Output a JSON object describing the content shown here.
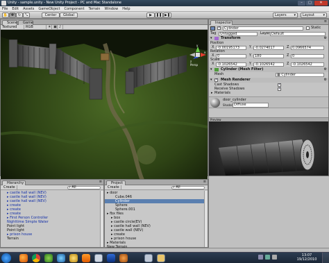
{
  "window": {
    "title": "Unity - sample.unity - New Unity Project - PC and Mac Standalone"
  },
  "menu": [
    "File",
    "Edit",
    "Assets",
    "GameObject",
    "Component",
    "Terrain",
    "Window",
    "Help"
  ],
  "toolbar": {
    "pivot_label": "Center",
    "space_label": "Global",
    "layers_label": "Layers",
    "layout_label": "Layout"
  },
  "scene_panel": {
    "tabs": [
      "Scene",
      "Game"
    ],
    "draw_mode": "Textured",
    "render_mode": "RGB",
    "persp_label": "Persp",
    "gizmo_y": "y",
    "gizmo_x": "x",
    "gizmo_z": "z"
  },
  "inspector": {
    "tab": "Inspector",
    "object_name": "Cylinder",
    "static_label": "Static",
    "tag_label": "Tag",
    "tag_value": "Untagged",
    "layer_label": "Layer",
    "layer_value": "Default",
    "transform": {
      "title": "Transform",
      "position_label": "Position",
      "position": {
        "x": "-0.00195173",
        "y": "-0.0274017",
        "z": "0.0966574"
      },
      "rotation_label": "Rotation",
      "rotation": {
        "x": "0",
        "y": "180",
        "z": "0"
      },
      "scale_label": "Scale",
      "scale": {
        "x": "-0.1026542",
        "y": "-0.1026542",
        "z": "-0.1026542"
      }
    },
    "mesh_filter": {
      "title": "Cylinder (Mesh Filter)",
      "mesh_label": "Mesh",
      "mesh_value": "Cylinder"
    },
    "mesh_renderer": {
      "title": "Mesh Renderer",
      "cast_label": "Cast Shadows",
      "receive_label": "Receive Shadows",
      "materials_label": "Materials"
    },
    "material": {
      "name": "door_cylinder",
      "shader_label": "Shader",
      "shader_value": "Diffuse"
    },
    "preview_label": "Preview"
  },
  "hierarchy": {
    "tab": "Hierarchy",
    "create_label": "Create",
    "search_placeholder": "All",
    "items": [
      {
        "label": "castle hall wall (NEV)",
        "indent": 1,
        "arrow": true,
        "blue": true,
        "selected": false
      },
      {
        "label": "castle hall wall (NEV)",
        "indent": 1,
        "arrow": true,
        "blue": true,
        "selected": false
      },
      {
        "label": "castle hall wall (NEV)",
        "indent": 1,
        "arrow": true,
        "blue": true,
        "selected": false
      },
      {
        "label": "create",
        "indent": 1,
        "arrow": true,
        "blue": true,
        "selected": false
      },
      {
        "label": "create",
        "indent": 1,
        "arrow": true,
        "blue": true,
        "selected": false
      },
      {
        "label": "create",
        "indent": 1,
        "arrow": true,
        "blue": true,
        "selected": false
      },
      {
        "label": "First Person Controller",
        "indent": 1,
        "arrow": true,
        "blue": true,
        "selected": false
      },
      {
        "label": "Nighttime Simple Water",
        "indent": 1,
        "arrow": false,
        "blue": true,
        "selected": false
      },
      {
        "label": "Point light",
        "indent": 1,
        "arrow": false,
        "blue": false,
        "selected": false
      },
      {
        "label": "Point light",
        "indent": 1,
        "arrow": false,
        "blue": false,
        "selected": false
      },
      {
        "label": "prison house",
        "indent": 1,
        "arrow": true,
        "blue": true,
        "selected": false
      },
      {
        "label": "Terrain",
        "indent": 1,
        "arrow": false,
        "blue": false,
        "selected": false
      }
    ]
  },
  "project": {
    "tab": "Project",
    "create_label": "Create",
    "search_placeholder": "All",
    "items": [
      {
        "label": "door",
        "indent": 0,
        "arrow": true,
        "blue": false,
        "selected": false
      },
      {
        "label": "Cube.046",
        "indent": 2,
        "arrow": false,
        "blue": false,
        "selected": false
      },
      {
        "label": "Cylinder",
        "indent": 2,
        "arrow": false,
        "blue": false,
        "selected": true
      },
      {
        "label": "Sphere",
        "indent": 2,
        "arrow": false,
        "blue": false,
        "selected": false
      },
      {
        "label": "Sphere.001",
        "indent": 2,
        "arrow": false,
        "blue": false,
        "selected": false
      },
      {
        "label": "fbx files",
        "indent": 0,
        "arrow": true,
        "blue": false,
        "selected": false
      },
      {
        "label": "box",
        "indent": 1,
        "arrow": true,
        "blue": false,
        "selected": false
      },
      {
        "label": "castle circle(EV)",
        "indent": 1,
        "arrow": true,
        "blue": false,
        "selected": false
      },
      {
        "label": "castle hall wall (NEV)",
        "indent": 1,
        "arrow": true,
        "blue": false,
        "selected": false
      },
      {
        "label": "castle wall (NEV)",
        "indent": 1,
        "arrow": true,
        "blue": false,
        "selected": false
      },
      {
        "label": "create",
        "indent": 1,
        "arrow": true,
        "blue": false,
        "selected": false
      },
      {
        "label": "prison house",
        "indent": 1,
        "arrow": true,
        "blue": false,
        "selected": false
      },
      {
        "label": "Materials",
        "indent": 0,
        "arrow": true,
        "blue": false,
        "selected": false
      },
      {
        "label": "New Terrain",
        "indent": 0,
        "arrow": false,
        "blue": false,
        "selected": false
      }
    ]
  },
  "taskbar": {
    "time": "13:07",
    "date": "19/12/2010",
    "icons": [
      "start-orb-icon",
      "firefox-icon",
      "chrome-icon",
      "messenger-icon",
      "media-player-icon",
      "explorer-icon",
      "vlc-icon",
      "unity-icon",
      "photoshop-icon",
      "blender-icon",
      "notepad-icon",
      "folder-icon"
    ]
  }
}
